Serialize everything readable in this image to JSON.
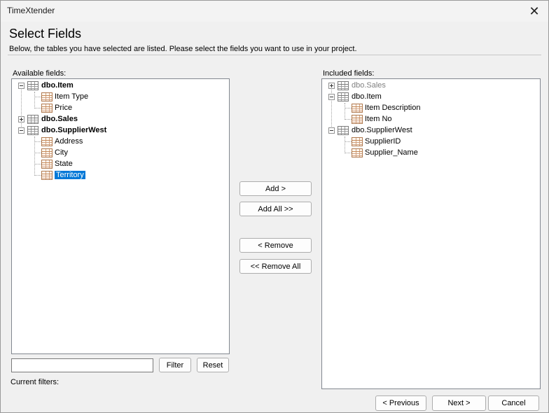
{
  "window": {
    "title": "TimeXtender"
  },
  "header": {
    "title": "Select Fields",
    "description": "Below, the tables you have selected are listed. Please select the fields you want to use in your project."
  },
  "available": {
    "label": "Available fields:",
    "tables": [
      {
        "name": "dbo.Item",
        "expanded": true,
        "fields": [
          "Item Type",
          "Price"
        ]
      },
      {
        "name": "dbo.Sales",
        "expanded": false,
        "fields": []
      },
      {
        "name": "dbo.SupplierWest",
        "expanded": true,
        "fields": [
          "Address",
          "City",
          "State",
          "Territory"
        ],
        "selected_field": "Territory"
      }
    ]
  },
  "included": {
    "label": "Included fields:",
    "tables": [
      {
        "name": "dbo.Sales",
        "expanded": false,
        "fields": [],
        "state": "grayed"
      },
      {
        "name": "dbo.Item",
        "expanded": true,
        "fields": [
          "Item Description",
          "Item No"
        ]
      },
      {
        "name": "dbo.SupplierWest",
        "expanded": true,
        "fields": [
          "SupplierID",
          "Supplier_Name"
        ]
      }
    ]
  },
  "actions": {
    "add": "Add >",
    "add_all": "Add All >>",
    "remove": "< Remove",
    "remove_all": "<< Remove All"
  },
  "filter": {
    "value": "",
    "filter_label": "Filter",
    "reset_label": "Reset",
    "current_filters_label": "Current filters:"
  },
  "footer": {
    "previous": "< Previous",
    "next": "Next >",
    "cancel": "Cancel"
  },
  "icons": {
    "close": "close-icon",
    "table": "table-icon",
    "field": "field-icon",
    "expand": "plus-expander-icon",
    "collapse": "minus-expander-icon"
  },
  "colors": {
    "selection": "#0078d7",
    "grayed_text": "#808080"
  }
}
